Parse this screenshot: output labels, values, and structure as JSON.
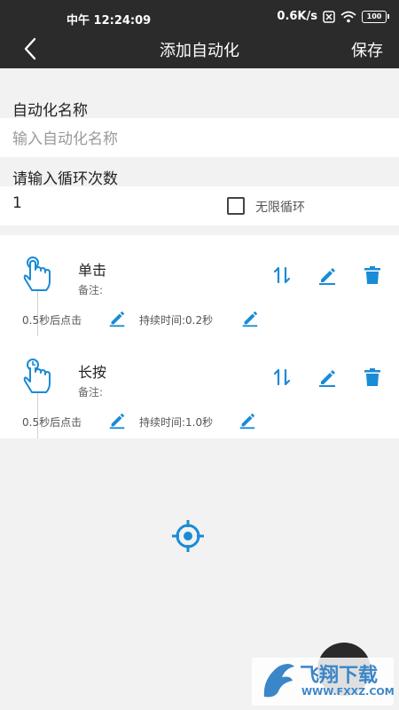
{
  "status": {
    "time": "中午 12:24:09",
    "speed": "0.6K/s",
    "battery": "100"
  },
  "nav": {
    "title": "添加自动化",
    "save_label": "保存"
  },
  "form": {
    "name_label": "自动化名称",
    "name_placeholder": "输入自动化名称",
    "name_value": "",
    "loop_label": "请输入循环次数",
    "loop_value": "1",
    "infinite_label": "无限循环",
    "infinite_checked": false
  },
  "steps": [
    {
      "name": "单击",
      "note": "备注:",
      "delay": "0.5秒后点击",
      "duration": "持续时间:0.2秒",
      "icon": "tap-hand-icon"
    },
    {
      "name": "长按",
      "note": "备注:",
      "delay": "0.5秒后点击",
      "duration": "持续时间:1.0秒",
      "icon": "long-press-hand-icon"
    }
  ],
  "colors": {
    "accent": "#1a8bd6",
    "header": "#2b2b2b"
  },
  "watermark": {
    "main": "飞翔下载",
    "sub": "WWW.FXXZ.COM"
  }
}
